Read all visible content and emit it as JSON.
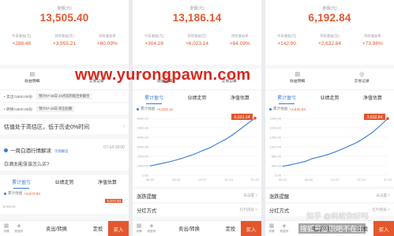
{
  "watermark": "www.yurongpawn.com",
  "overlay": {
    "zhihu": "知乎 @蚂蚁你好吗",
    "sohu": "搜狐号@职吧不在主"
  },
  "common": {
    "amount_label": "金额(元)",
    "stat_labels": [
      "今日收益(元)",
      "持有收益(元)",
      "持有收益率"
    ],
    "actions": [
      "收益明细",
      "交易记录"
    ],
    "tabs": [
      "累计盈亏",
      "业绩走势",
      "净值估算"
    ],
    "legend_label": "累计收益",
    "bottom": {
      "icon1": "详情",
      "icon2": "财富号",
      "sell": "卖出/转换",
      "fixed": "定投",
      "buy": "买入"
    },
    "menu1": "涨跌提醒",
    "menu1_right": "未设置 >",
    "menu2": "分红方式",
    "menu2_right": "红利再投 >"
  },
  "p1": {
    "amount": "13,505.40",
    "stats": [
      "+288.48",
      "+3,955.21",
      "+60.09%"
    ],
    "rows": [
      {
        "label": "• 卖出/1500.00份",
        "tag": "预计07-16日 24点前到账至余额宝"
      },
      {
        "label": "• 转换/1500.00份",
        "tag": "预计07-16日 转出份额"
      }
    ],
    "estimate": "估值处于高估区，低于历史0%时间",
    "news_title": "一周白酒行情解读",
    "news_badge": "市场解读",
    "news_date": "07-14 18:00",
    "news_q": "白酒太能涨该怎么买?",
    "legend_value": "+5,974.93",
    "chart_last": "5,974.93",
    "y_top": "6,000.00"
  },
  "p2": {
    "amount": "13,186.14",
    "stats": [
      "+304.28",
      "+6,023.14",
      "+84.09%"
    ],
    "legend_value": "+6,023.14",
    "chart_last": "6,023.14",
    "yticks": [
      "6000.00",
      "5000.00",
      "4000.00",
      "3000.00",
      "2000.00",
      "1000.00",
      "0.00"
    ],
    "xticks": [
      "06-23",
      "06-30",
      "07-07",
      "07-14",
      "07-23"
    ]
  },
  "p3": {
    "amount": "6,192.84",
    "stats": [
      "+142.90",
      "+2,632.84",
      "+73.96%"
    ],
    "legend_value": "+2,632.84",
    "chart_last": "2,632.84",
    "yticks": [
      "2640.00",
      "2200.00",
      "1760.00",
      "1320.00",
      "880.00",
      "440.00",
      "0.00"
    ],
    "xticks": [
      "06-23",
      "06-30",
      "07-07",
      "07-14",
      "07-23"
    ]
  },
  "chart_data": [
    {
      "type": "line",
      "series": [
        {
          "name": "累计收益",
          "values": [
            980,
            1150,
            1320,
            1500,
            1720,
            1980,
            2250,
            2600,
            2900,
            3350,
            3750,
            4250,
            4850,
            5450,
            6023.14
          ]
        }
      ],
      "ylim": [
        0,
        6000
      ]
    },
    {
      "type": "line",
      "series": [
        {
          "name": "累计收益",
          "values": [
            420,
            480,
            560,
            640,
            780,
            860,
            960,
            1080,
            1230,
            1380,
            1540,
            1760,
            2000,
            2300,
            2632.84
          ]
        }
      ],
      "ylim": [
        0,
        2640
      ]
    }
  ],
  "colors": {
    "accent": "#e4572e",
    "blue": "#3a7bd5"
  }
}
